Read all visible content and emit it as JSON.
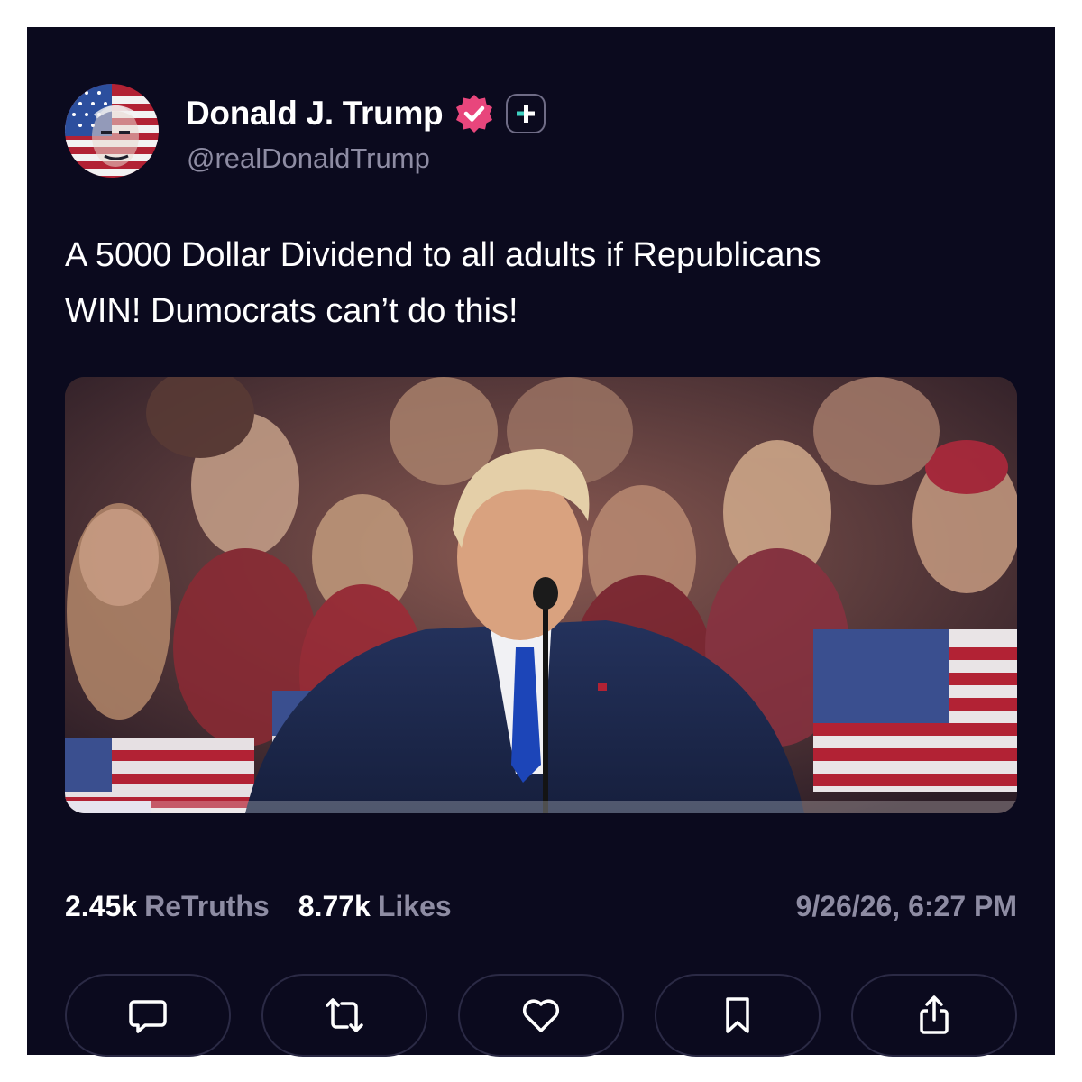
{
  "post": {
    "author": {
      "display_name": "Donald J. Trump",
      "handle": "@realDonaldTrump",
      "verified_icon": "verified-check-badge",
      "plus_icon": "plus-badge-icon"
    },
    "text_line1": "A 5000 Dollar Dividend to all adults if Republicans",
    "text_line2": "WIN! Dumocrats can’t do this!",
    "media": {
      "type": "video",
      "playback_progress": 0.09
    },
    "stats": {
      "retruths_count": "2.45k",
      "retruths_label": "ReTruths",
      "likes_count": "8.77k",
      "likes_label": "Likes",
      "timestamp": "9/26/26, 6:27 PM"
    },
    "actions": [
      {
        "icon": "comment-icon"
      },
      {
        "icon": "retruth-icon"
      },
      {
        "icon": "heart-icon"
      },
      {
        "icon": "bookmark-icon"
      },
      {
        "icon": "share-icon"
      }
    ]
  },
  "colors": {
    "background": "#0b0a1e",
    "text_primary": "#ffffff",
    "text_secondary": "#8e8ca3",
    "verified_badge": "#e8467c",
    "plus_accent": "#3ed0c0",
    "button_border": "#2b2a45"
  }
}
